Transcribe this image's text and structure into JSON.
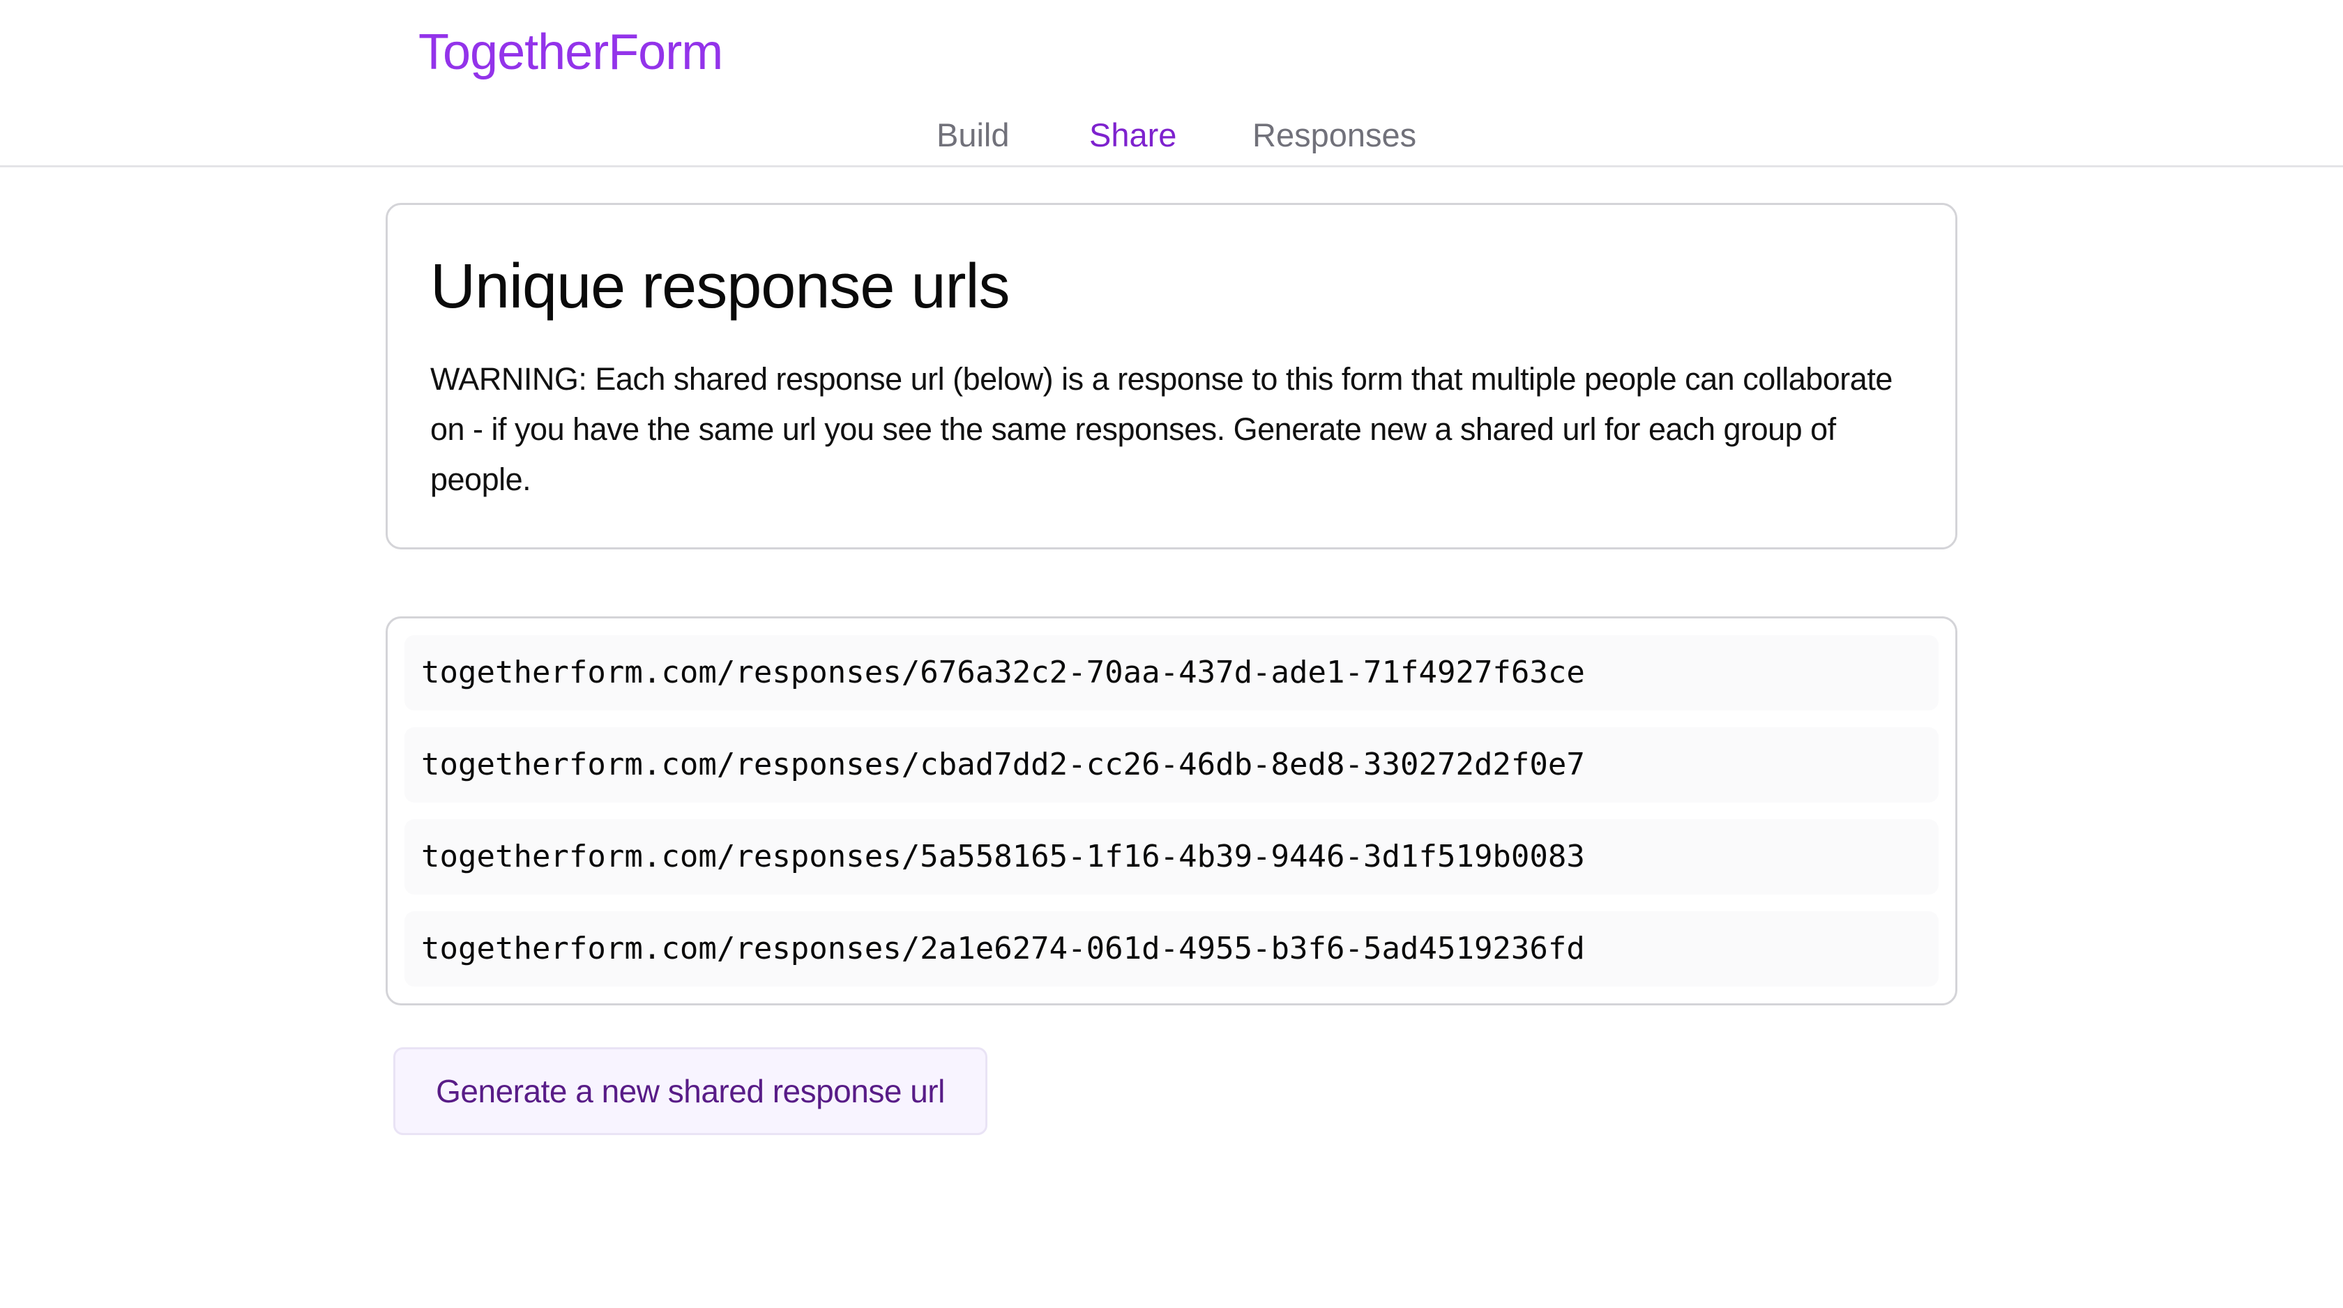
{
  "header": {
    "brand": "TogetherForm",
    "tabs": [
      {
        "label": "Build"
      },
      {
        "label": "Share"
      },
      {
        "label": "Responses"
      }
    ]
  },
  "info_card": {
    "title": "Unique response urls",
    "text": "WARNING: Each shared response url (below) is a response to this form that multiple people can collaborate on - if you have the same url you see the same responses. Generate new a shared url for each group of people."
  },
  "urls": [
    "togetherform.com/responses/676a32c2-70aa-437d-ade1-71f4927f63ce",
    "togetherform.com/responses/cbad7dd2-cc26-46db-8ed8-330272d2f0e7",
    "togetherform.com/responses/5a558165-1f16-4b39-9446-3d1f519b0083",
    "togetherform.com/responses/2a1e6274-061d-4955-b3f6-5ad4519236fd"
  ],
  "actions": {
    "generate_label": "Generate a new shared response url"
  },
  "colors": {
    "brand": "#9333ea",
    "active_tab": "#7e22ce",
    "inactive_tab": "#71717a",
    "button_text": "#581c87",
    "button_bg": "#f8f4ff"
  }
}
